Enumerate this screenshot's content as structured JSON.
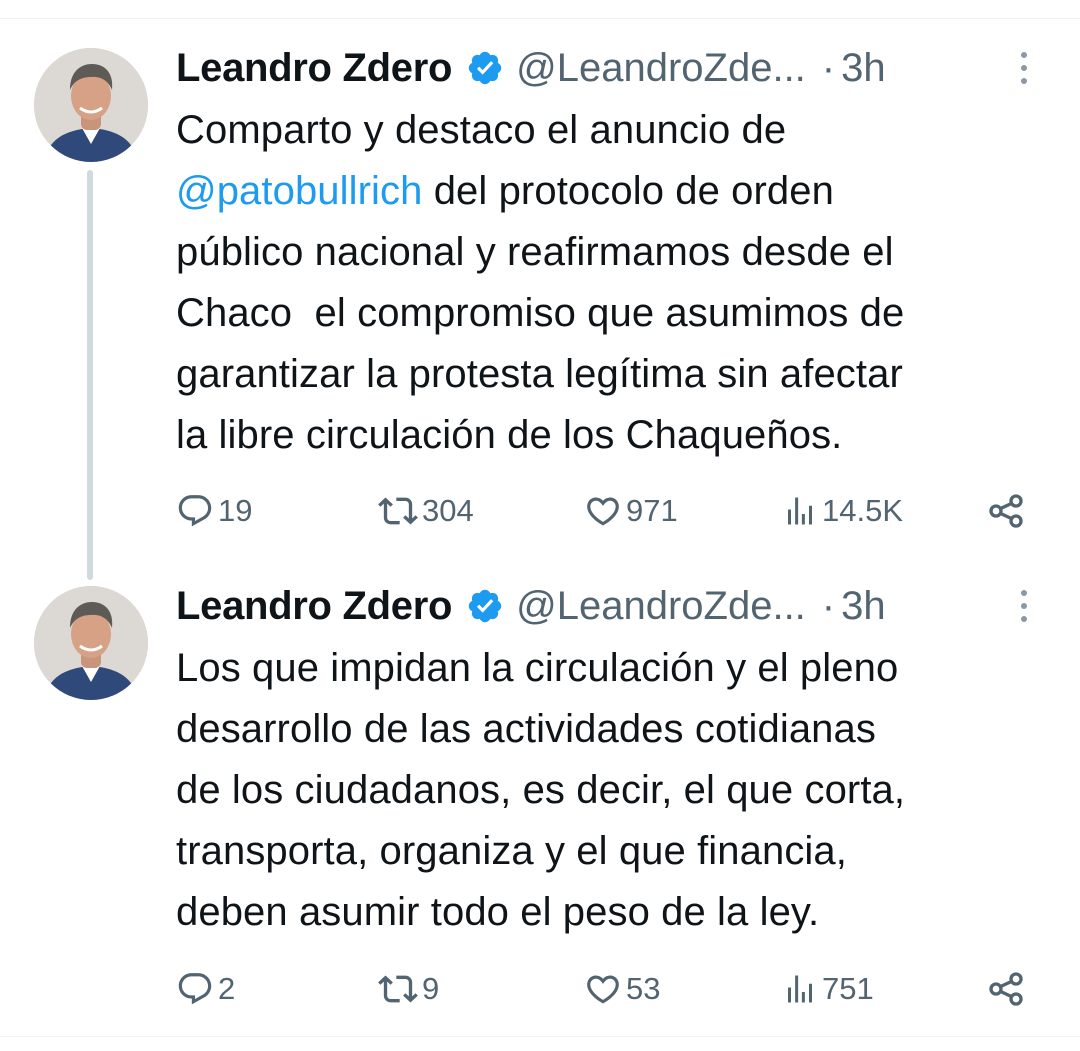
{
  "tweets": [
    {
      "author": {
        "name": "Leandro Zdero",
        "handle": "@LeandroZde...",
        "verified": true,
        "avatar_icon": "profile-photo-man-icon"
      },
      "separator": "·",
      "time": "3h",
      "body_lines": [
        "Comparto y destaco el anuncio de",
        "@patobullrich",
        " del protocolo de orden",
        "público nacional y reafirmamos desde el",
        "Chaco  el compromiso que asumimos de",
        "garantizar la protesta legítima sin afectar",
        "la libre circulación de los Chaqueños."
      ],
      "stats": {
        "replies": "19",
        "retweets": "304",
        "likes": "971",
        "views": "14.5K"
      }
    },
    {
      "author": {
        "name": "Leandro Zdero",
        "handle": "@LeandroZde...",
        "verified": true,
        "avatar_icon": "profile-photo-man-icon"
      },
      "separator": "·",
      "time": "3h",
      "body_lines": [
        "Los que impidan la circulación y el pleno",
        "desarrollo de las actividades cotidianas",
        "de los ciudadanos, es decir, el que corta,",
        "transporta, organiza y el que financia,",
        "deben asumir todo el peso de la ley."
      ],
      "stats": {
        "replies": "2",
        "retweets": "9",
        "likes": "53",
        "views": "751"
      }
    }
  ],
  "colors": {
    "text": "#0f1419",
    "secondary": "#536471",
    "link": "#1d9bf0",
    "verified": "#1d9bf0",
    "divider": "#eff3f4",
    "thread_line": "#cfd9de"
  },
  "icons": {
    "reply": "speech-bubble-icon",
    "retweet": "retweet-arrows-icon",
    "like": "heart-icon",
    "views": "bar-chart-icon",
    "share": "share-nodes-icon",
    "more": "vertical-dots-icon",
    "verified": "verified-badge-icon"
  }
}
